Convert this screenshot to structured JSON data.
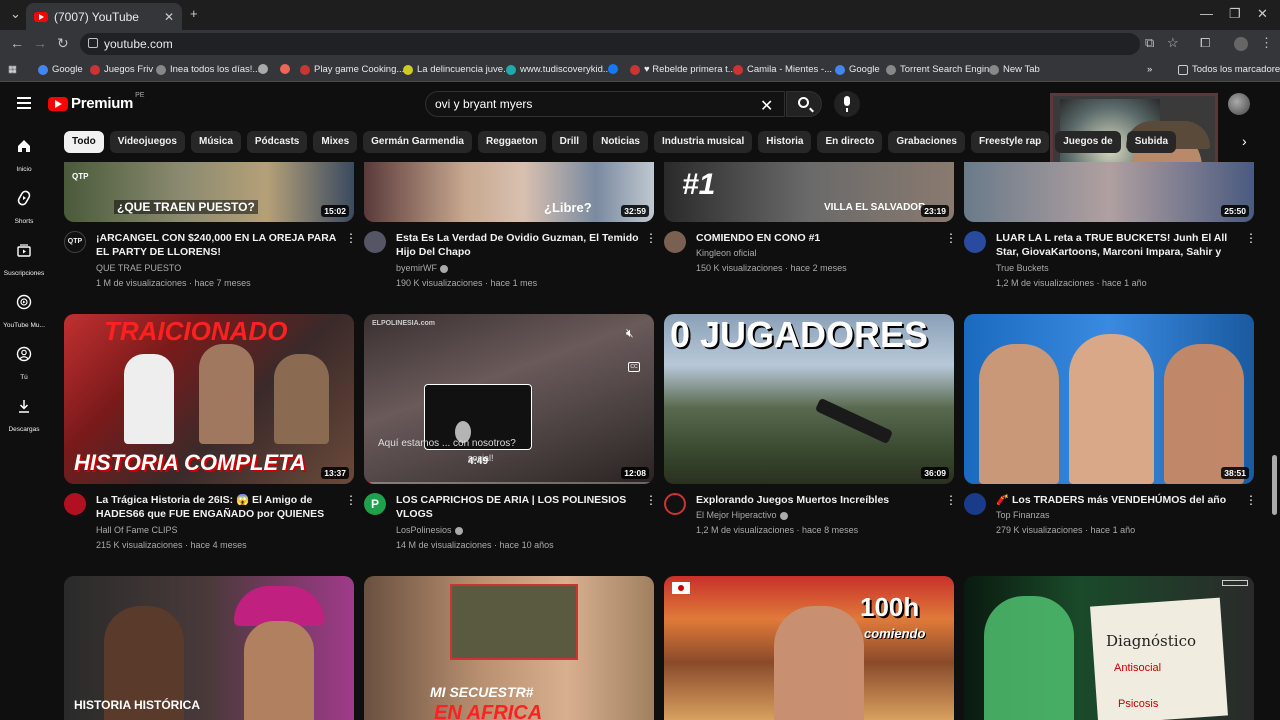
{
  "browser": {
    "tab_title": "(7007) YouTube",
    "url": "youtube.com",
    "bookmarks": [
      "Google",
      "Juegos Friv",
      "Inea todos los días!...",
      "",
      "",
      "Play game Cooking...",
      "La delincuencia juve...",
      "www.tudiscoverykid...",
      "",
      "♥ Rebelde primera t...",
      "Camila - Mientes -...",
      "Google",
      "Torrent Search Engine",
      "New Tab"
    ],
    "all_bookmarks": "Todos los marcadores"
  },
  "header": {
    "logo": "Premium",
    "country": "PE",
    "search_value": "ovi y bryant myers"
  },
  "sidebar": [
    {
      "label": "Inicio",
      "icon": "home-icon"
    },
    {
      "label": "Shorts",
      "icon": "shorts-icon"
    },
    {
      "label": "Suscripciones",
      "icon": "subscriptions-icon"
    },
    {
      "label": "YouTube Mu...",
      "icon": "youtube-music-icon"
    },
    {
      "label": "Tú",
      "icon": "you-icon"
    },
    {
      "label": "Descargas",
      "icon": "download-icon"
    }
  ],
  "chips": [
    "Todo",
    "Videojuegos",
    "Música",
    "Pódcasts",
    "Mixes",
    "Germán Garmendia",
    "Reggaeton",
    "Drill",
    "Noticias",
    "Industria musical",
    "Historia",
    "En directo",
    "Grabaciones",
    "Freestyle rap",
    "Juegos de",
    "Subida"
  ],
  "row1": [
    {
      "title": "¡ARCANGEL CON $240,000 EN LA OREJA PARA EL PARTY DE LLORENS!",
      "channel": "QUE TRAE PUESTO",
      "stats": "1 M de visualizaciones · hace 7 meses",
      "duration": "15:02",
      "thumb_text": "¿QUE TRAEN PUESTO?",
      "avatar_text": "QTP"
    },
    {
      "title": "Esta Es La Verdad De Ovidio Guzman, El Temido Hijo Del Chapo",
      "channel": "byemirWF",
      "stats": "190 K visualizaciones · hace 1 mes",
      "duration": "32:59",
      "thumb_text": "¿Libre?"
    },
    {
      "title": "COMIENDO EN CONO #1",
      "channel": "Kingleon oficial",
      "stats": "150 K visualizaciones · hace 2 meses",
      "duration": "23:19",
      "thumb_text": "#1",
      "thumb_text2": "VILLA EL SALVADOR"
    },
    {
      "title": "LUAR LA L reta a TRUE BUCKETS! Junh El All Star, GiovaKartoons, Marconi Impara, Sahir y Más!",
      "channel": "True Buckets",
      "stats": "1,2 M de visualizaciones · hace 1 año",
      "duration": "25:50"
    }
  ],
  "row2": [
    {
      "title": "La Trágica Historia de 26IS: 😱 El Amigo de HADES66 que FUE ENGAÑADO por QUIENES MA...",
      "channel": "Hall Of Fame CLIPS",
      "stats": "215 K visualizaciones · hace 4 meses",
      "duration": "13:37",
      "thumb_text": "HISTORIA COMPLETA",
      "thumb_text_top": "TRAICIONADO"
    },
    {
      "title": "LOS CAPRICHOS DE ARIA | LOS POLINESIOS VLOGS",
      "channel": "LosPolinesios",
      "stats": "14 M de visualizaciones · hace 10 años",
      "duration": "12:08",
      "hover_time": "4:49",
      "caption": "Aquí estamos ... con nosotros?",
      "caption2": "social!",
      "watermark": "ELPOLINESIA.com",
      "progress": 0.02
    },
    {
      "title": "Explorando Juegos Muertos Increíbles",
      "channel": "El Mejor Hiperactivo",
      "stats": "1,2 M de visualizaciones · hace 8 meses",
      "duration": "36:09",
      "thumb_text": "0 JUGADORES"
    },
    {
      "title": "🧨 Los TRADERS más VENDEHÚMOS del año",
      "channel": "Top Finanzas",
      "stats": "279 K visualizaciones · hace 1 año",
      "duration": "38:51"
    }
  ],
  "row3": [
    {
      "thumb_text": "HISTORIA HISTÓRICA"
    },
    {
      "thumb_text": "MI SECUESTR#",
      "thumb_text2": "EN AFRICA"
    },
    {
      "thumb_text": "100h",
      "thumb_text2": "comiendo"
    },
    {
      "thumb_text": "Diagnóstico",
      "thumb_text2": "Antisocial",
      "thumb_text3": "Psicosis"
    }
  ]
}
